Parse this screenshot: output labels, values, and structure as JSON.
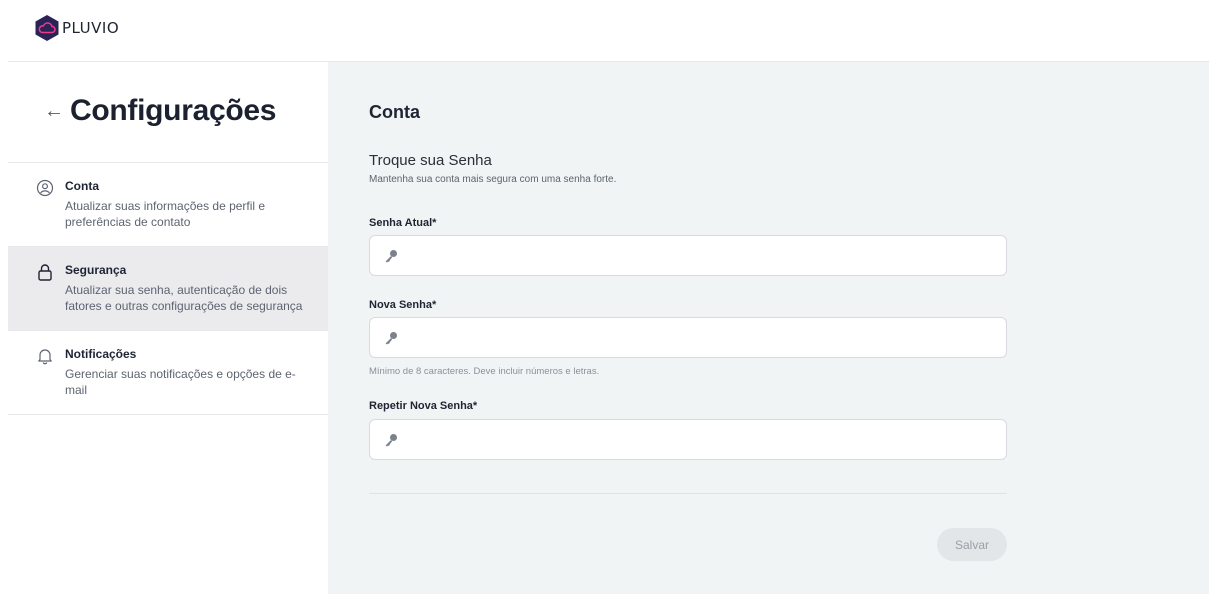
{
  "brand": {
    "name": "PLUVIO",
    "logo_color": "#2a2356",
    "accent": "#ee3a8c"
  },
  "sidebar": {
    "back_icon": "arrow-left-icon",
    "title": "Configurações",
    "items": [
      {
        "icon": "user-circle-icon",
        "label": "Conta",
        "description": "Atualizar suas informações de perfil e preferências de contato",
        "active": false
      },
      {
        "icon": "lock-icon",
        "label": "Segurança",
        "description": "Atualizar sua senha, autenticação de dois fatores e outras configurações de segurança",
        "active": true
      },
      {
        "icon": "bell-icon",
        "label": "Notificações",
        "description": "Gerenciar suas notificações e opções de e-mail",
        "active": false
      }
    ]
  },
  "main": {
    "section_title": "Conta",
    "subtitle": "Troque sua Senha",
    "subtitle_desc": "Mantenha sua conta mais segura com uma senha forte.",
    "fields": {
      "current": {
        "label": "Senha Atual*",
        "value": "",
        "icon": "key-icon"
      },
      "new": {
        "label": "Nova Senha*",
        "value": "",
        "icon": "key-icon",
        "hint": "Mínimo de 8 caracteres. Deve incluir números e letras."
      },
      "repeat": {
        "label": "Repetir Nova Senha*",
        "value": "",
        "icon": "key-icon"
      }
    },
    "save_label": "Salvar"
  }
}
